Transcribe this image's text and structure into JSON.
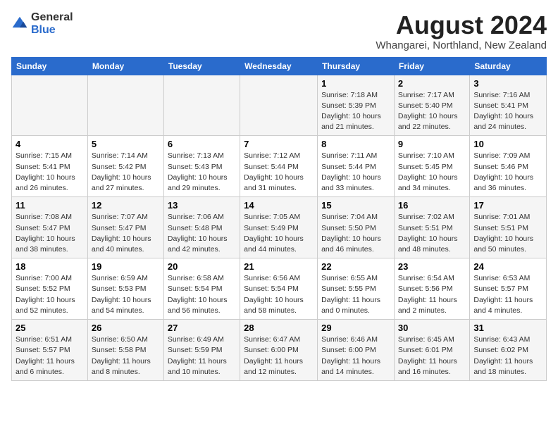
{
  "header": {
    "logo_general": "General",
    "logo_blue": "Blue",
    "title": "August 2024",
    "subtitle": "Whangarei, Northland, New Zealand"
  },
  "calendar": {
    "days_of_week": [
      "Sunday",
      "Monday",
      "Tuesday",
      "Wednesday",
      "Thursday",
      "Friday",
      "Saturday"
    ],
    "weeks": [
      [
        {
          "day": "",
          "info": ""
        },
        {
          "day": "",
          "info": ""
        },
        {
          "day": "",
          "info": ""
        },
        {
          "day": "",
          "info": ""
        },
        {
          "day": "1",
          "info": "Sunrise: 7:18 AM\nSunset: 5:39 PM\nDaylight: 10 hours and 21 minutes."
        },
        {
          "day": "2",
          "info": "Sunrise: 7:17 AM\nSunset: 5:40 PM\nDaylight: 10 hours and 22 minutes."
        },
        {
          "day": "3",
          "info": "Sunrise: 7:16 AM\nSunset: 5:41 PM\nDaylight: 10 hours and 24 minutes."
        }
      ],
      [
        {
          "day": "4",
          "info": "Sunrise: 7:15 AM\nSunset: 5:41 PM\nDaylight: 10 hours and 26 minutes."
        },
        {
          "day": "5",
          "info": "Sunrise: 7:14 AM\nSunset: 5:42 PM\nDaylight: 10 hours and 27 minutes."
        },
        {
          "day": "6",
          "info": "Sunrise: 7:13 AM\nSunset: 5:43 PM\nDaylight: 10 hours and 29 minutes."
        },
        {
          "day": "7",
          "info": "Sunrise: 7:12 AM\nSunset: 5:44 PM\nDaylight: 10 hours and 31 minutes."
        },
        {
          "day": "8",
          "info": "Sunrise: 7:11 AM\nSunset: 5:44 PM\nDaylight: 10 hours and 33 minutes."
        },
        {
          "day": "9",
          "info": "Sunrise: 7:10 AM\nSunset: 5:45 PM\nDaylight: 10 hours and 34 minutes."
        },
        {
          "day": "10",
          "info": "Sunrise: 7:09 AM\nSunset: 5:46 PM\nDaylight: 10 hours and 36 minutes."
        }
      ],
      [
        {
          "day": "11",
          "info": "Sunrise: 7:08 AM\nSunset: 5:47 PM\nDaylight: 10 hours and 38 minutes."
        },
        {
          "day": "12",
          "info": "Sunrise: 7:07 AM\nSunset: 5:47 PM\nDaylight: 10 hours and 40 minutes."
        },
        {
          "day": "13",
          "info": "Sunrise: 7:06 AM\nSunset: 5:48 PM\nDaylight: 10 hours and 42 minutes."
        },
        {
          "day": "14",
          "info": "Sunrise: 7:05 AM\nSunset: 5:49 PM\nDaylight: 10 hours and 44 minutes."
        },
        {
          "day": "15",
          "info": "Sunrise: 7:04 AM\nSunset: 5:50 PM\nDaylight: 10 hours and 46 minutes."
        },
        {
          "day": "16",
          "info": "Sunrise: 7:02 AM\nSunset: 5:51 PM\nDaylight: 10 hours and 48 minutes."
        },
        {
          "day": "17",
          "info": "Sunrise: 7:01 AM\nSunset: 5:51 PM\nDaylight: 10 hours and 50 minutes."
        }
      ],
      [
        {
          "day": "18",
          "info": "Sunrise: 7:00 AM\nSunset: 5:52 PM\nDaylight: 10 hours and 52 minutes."
        },
        {
          "day": "19",
          "info": "Sunrise: 6:59 AM\nSunset: 5:53 PM\nDaylight: 10 hours and 54 minutes."
        },
        {
          "day": "20",
          "info": "Sunrise: 6:58 AM\nSunset: 5:54 PM\nDaylight: 10 hours and 56 minutes."
        },
        {
          "day": "21",
          "info": "Sunrise: 6:56 AM\nSunset: 5:54 PM\nDaylight: 10 hours and 58 minutes."
        },
        {
          "day": "22",
          "info": "Sunrise: 6:55 AM\nSunset: 5:55 PM\nDaylight: 11 hours and 0 minutes."
        },
        {
          "day": "23",
          "info": "Sunrise: 6:54 AM\nSunset: 5:56 PM\nDaylight: 11 hours and 2 minutes."
        },
        {
          "day": "24",
          "info": "Sunrise: 6:53 AM\nSunset: 5:57 PM\nDaylight: 11 hours and 4 minutes."
        }
      ],
      [
        {
          "day": "25",
          "info": "Sunrise: 6:51 AM\nSunset: 5:57 PM\nDaylight: 11 hours and 6 minutes."
        },
        {
          "day": "26",
          "info": "Sunrise: 6:50 AM\nSunset: 5:58 PM\nDaylight: 11 hours and 8 minutes."
        },
        {
          "day": "27",
          "info": "Sunrise: 6:49 AM\nSunset: 5:59 PM\nDaylight: 11 hours and 10 minutes."
        },
        {
          "day": "28",
          "info": "Sunrise: 6:47 AM\nSunset: 6:00 PM\nDaylight: 11 hours and 12 minutes."
        },
        {
          "day": "29",
          "info": "Sunrise: 6:46 AM\nSunset: 6:00 PM\nDaylight: 11 hours and 14 minutes."
        },
        {
          "day": "30",
          "info": "Sunrise: 6:45 AM\nSunset: 6:01 PM\nDaylight: 11 hours and 16 minutes."
        },
        {
          "day": "31",
          "info": "Sunrise: 6:43 AM\nSunset: 6:02 PM\nDaylight: 11 hours and 18 minutes."
        }
      ]
    ]
  }
}
